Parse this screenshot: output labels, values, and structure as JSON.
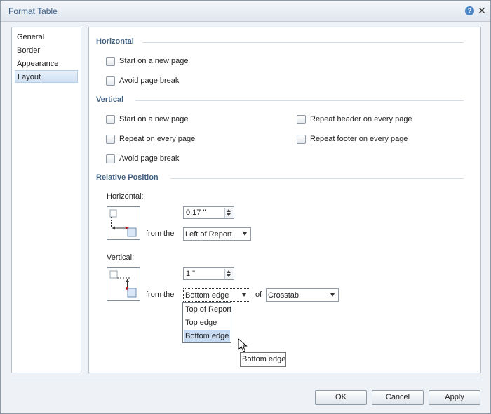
{
  "window": {
    "title": "Format Table"
  },
  "nav": {
    "items": [
      {
        "label": "General"
      },
      {
        "label": "Border"
      },
      {
        "label": "Appearance"
      },
      {
        "label": "Layout",
        "selected": true
      }
    ]
  },
  "horizontal_section": {
    "title": "Horizontal",
    "start_new_page": "Start on a new page",
    "avoid_page_break": "Avoid page break"
  },
  "vertical_section": {
    "title": "Vertical",
    "start_new_page": "Start on a new page",
    "repeat_every_page": "Repeat on every page",
    "avoid_page_break": "Avoid page break",
    "repeat_header": "Repeat header on every page",
    "repeat_footer": "Repeat footer on every page"
  },
  "relative_position": {
    "title": "Relative Position",
    "horizontal": {
      "label": "Horizontal:",
      "value": "0.17 \"",
      "from_label": "from the",
      "anchor": "Left of Report"
    },
    "vertical": {
      "label": "Vertical:",
      "value": "1 \"",
      "from_label": "from the",
      "anchor": "Bottom edge",
      "of_label": "of",
      "target": "Crosstab",
      "dropdown_options": [
        {
          "label": "Top of Report"
        },
        {
          "label": "Top edge"
        },
        {
          "label": "Bottom edge",
          "hovered": true
        }
      ],
      "tooltip": "Bottom edge"
    }
  },
  "buttons": {
    "ok": "OK",
    "cancel": "Cancel",
    "apply": "Apply"
  },
  "colors": {
    "accent": "#3a5f8b",
    "section_title": "#41607f",
    "selection": "#c7dbf3",
    "marker_red": "#c00000"
  }
}
